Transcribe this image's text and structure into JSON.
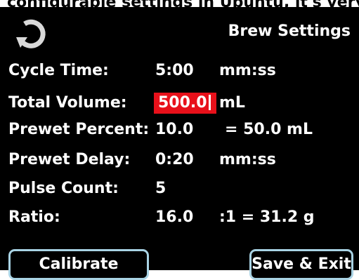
{
  "caption_cropped": "configurable settings in Ubuntu, it's very sensitive",
  "header": {
    "title": "Brew Settings",
    "back_icon": "refresh-back-icon"
  },
  "settings": [
    {
      "label": "Cycle Time:",
      "value": "5:00",
      "unit": "mm:ss"
    },
    {
      "label": "Total Volume:",
      "value": "500.0",
      "unit": "mL",
      "editing": true
    },
    {
      "label": "Prewet Percent:",
      "value": "10.0",
      "unit": "= 50.0 mL"
    },
    {
      "label": "Prewet Delay:",
      "value": "0:20",
      "unit": "mm:ss"
    },
    {
      "label": "Pulse Count:",
      "value": "5",
      "unit": ""
    },
    {
      "label": "Ratio:",
      "value": "16.0",
      "unit": ":1 = 31.2 g"
    }
  ],
  "buttons": {
    "calibrate": "Calibrate",
    "save_exit": "Save & Exit"
  },
  "colors": {
    "background": "#000000",
    "text": "#ffffff",
    "edit_highlight": "#e8101a",
    "button_border": "#a9d3e4"
  }
}
